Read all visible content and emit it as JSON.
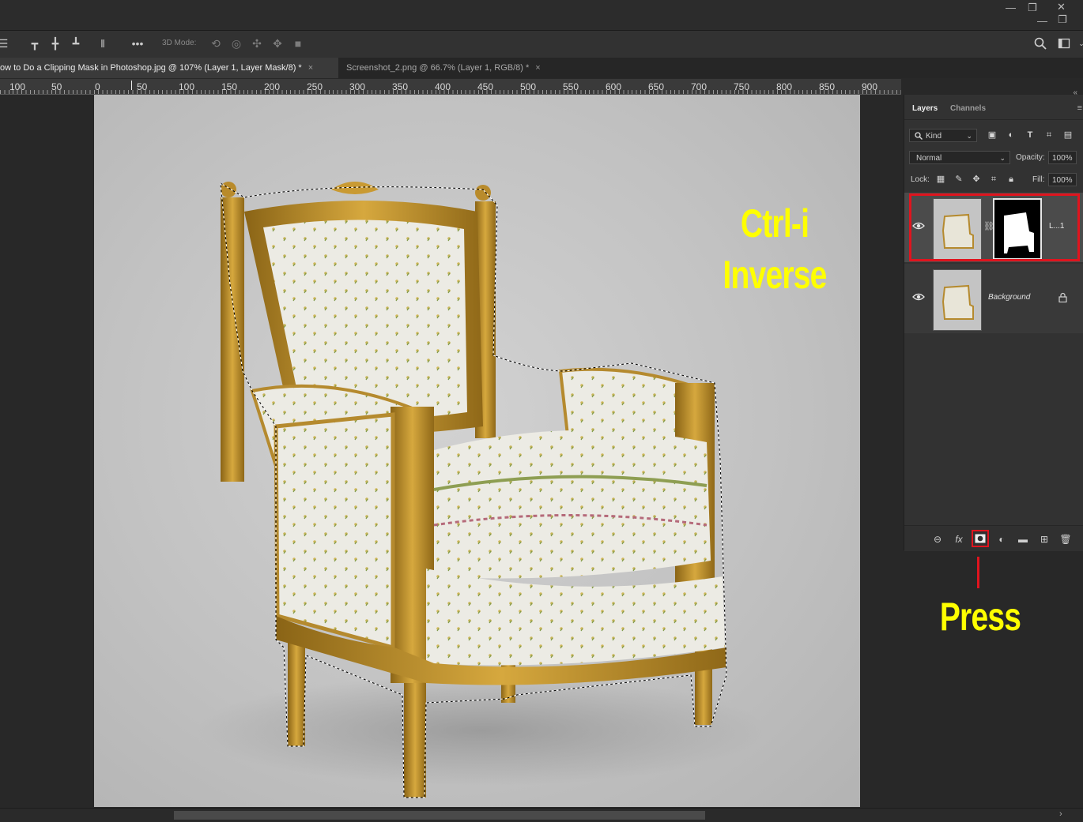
{
  "window": {
    "minimize": "—",
    "restore": "❐",
    "close": "✕"
  },
  "options_bar": {
    "label_3d_mode": "3D Mode:",
    "more": "•••"
  },
  "tabs": [
    {
      "label": "ow to Do a Clipping Mask in Photoshop.jpg @ 107% (Layer 1, Layer Mask/8) *",
      "close": "×"
    },
    {
      "label": "Screenshot_2.png @ 66.7% (Layer 1, RGB/8) *",
      "close": "×"
    }
  ],
  "ruler": {
    "ticks": [
      "100",
      "50",
      "0",
      "50",
      "100",
      "150",
      "200",
      "250",
      "300",
      "350",
      "400",
      "450",
      "500",
      "550",
      "600",
      "650",
      "700",
      "750",
      "800",
      "850",
      "900"
    ]
  },
  "annotations": {
    "instruction_line1": "Ctrl-i",
    "instruction_line2": "Inverse",
    "press": "Press"
  },
  "colors": {
    "annotation": "#ffff00",
    "highlight": "#e0141e",
    "panel_bg": "#323232",
    "canvas_bg": "#c4c4c4"
  },
  "layers_panel": {
    "tabs": [
      "Layers",
      "Channels"
    ],
    "filter_kind": "Kind",
    "blend_mode": "Normal",
    "opacity_label": "Opacity:",
    "opacity_value": "100%",
    "lock_label": "Lock:",
    "fill_label": "Fill:",
    "fill_value": "100%",
    "layers": [
      {
        "name": "L...1",
        "has_mask": true,
        "selected": true
      },
      {
        "name": "Background",
        "locked": true
      }
    ],
    "footer_icons": [
      "link-icon",
      "fx-icon",
      "add-mask-icon",
      "adjustment-icon",
      "folder-icon",
      "new-layer-icon",
      "trash-icon"
    ],
    "fx_label": "fx"
  }
}
